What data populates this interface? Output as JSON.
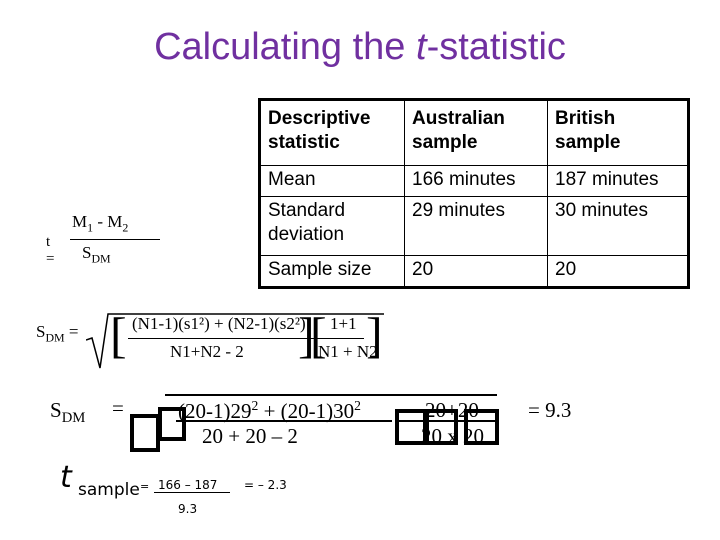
{
  "title": {
    "prefix": "Calculating the ",
    "italic": "t",
    "suffix": "-statistic"
  },
  "table": {
    "headers": [
      "Descriptive statistic",
      "Australian sample",
      "British sample"
    ],
    "rows": [
      [
        "Mean",
        "166 minutes",
        "187 minutes"
      ],
      [
        "Standard deviation",
        "29 minutes",
        "30 minutes"
      ],
      [
        "Sample size",
        "20",
        "20"
      ]
    ]
  },
  "formula_t": {
    "lhs": "t =",
    "numerator": "M1 - M2",
    "num_m1": "M",
    "num_sub1": "1",
    "num_minus": " - ",
    "num_m2": "M",
    "num_sub2": "2",
    "den_s": "S",
    "den_sub": "DM"
  },
  "formula_sdm": {
    "lhs_s": "S",
    "lhs_sub": "DM",
    "lhs_eq": "=",
    "left_bracket": "[",
    "right_bracket": "]",
    "num1": "(N1-1)(s1²) + (N2-1)(s2²)",
    "den1": "N1+N2 - 2",
    "num2": "1",
    "den2": "N1 + N2",
    "frac2_left": "1",
    "frac2_right": "1",
    "plus": "+"
  },
  "formula_calc": {
    "lhs_s": "S",
    "lhs_sub": "DM",
    "eq": "=",
    "numerator_a": "(20-1)29",
    "exp_a": "2",
    "numerator_plus": " + (20-1)30",
    "exp_b": "2",
    "denominator": "20 + 20 – 2",
    "num2": "20+20",
    "den2": "20 x 20",
    "result": "=  9.3"
  },
  "formula_tsample": {
    "t": "t",
    "sub": "sample",
    "eq": "=",
    "numerator": "166 – 187",
    "denominator": "9.3",
    "result": "= – 2.3"
  }
}
